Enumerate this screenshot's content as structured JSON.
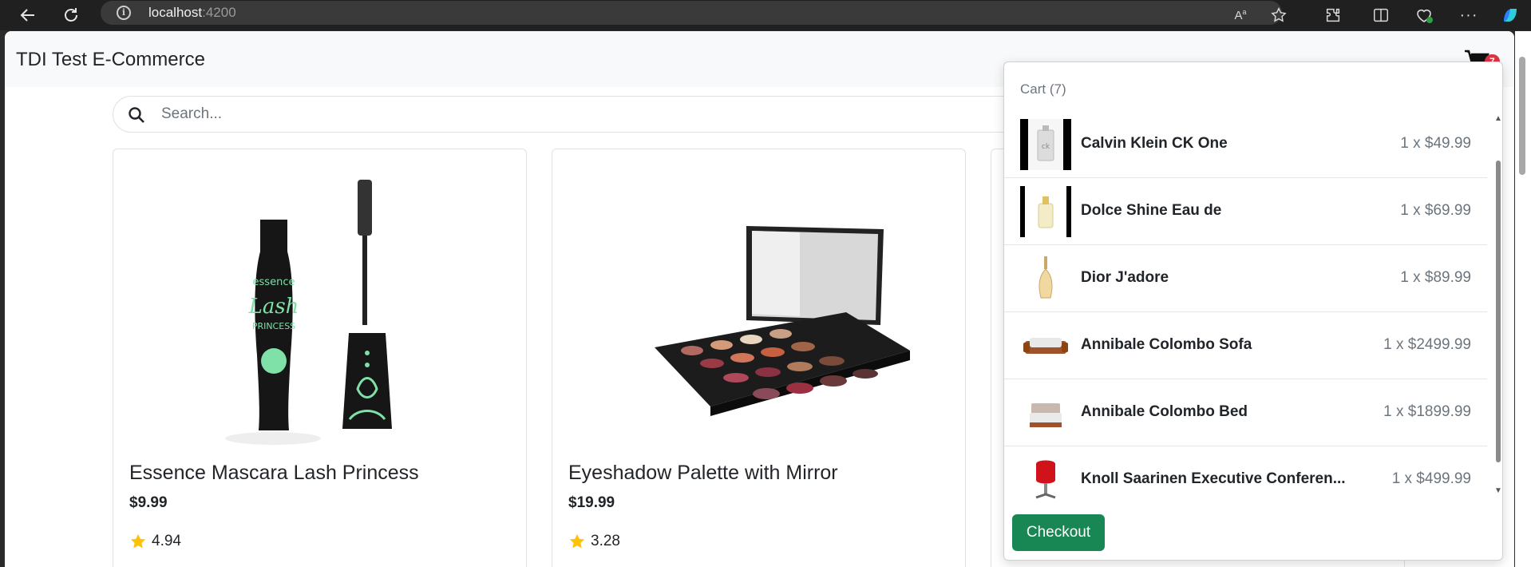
{
  "browser": {
    "url_host": "localhost",
    "url_port": ":4200"
  },
  "header": {
    "brand": "TDI Test E-Commerce",
    "cart_count": "7"
  },
  "search": {
    "placeholder": "Search..."
  },
  "products": [
    {
      "title": "Essence Mascara Lash Princess",
      "price": "$9.99",
      "rating": "4.94"
    },
    {
      "title": "Eyeshadow Palette with Mirror",
      "price": "$19.99",
      "rating": "3.28"
    }
  ],
  "cart": {
    "header": "Cart (7)",
    "items": [
      {
        "name": "Calvin Klein CK One",
        "qty": "1 x $49.99"
      },
      {
        "name": "Dolce Shine Eau de",
        "qty": "1 x $69.99"
      },
      {
        "name": "Dior J'adore",
        "qty": "1 x $89.99"
      },
      {
        "name": "Annibale Colombo Sofa",
        "qty": "1 x $2499.99"
      },
      {
        "name": "Annibale Colombo Bed",
        "qty": "1 x $1899.99"
      },
      {
        "name": "Knoll Saarinen Executive Conferen...",
        "qty": "1 x $499.99"
      }
    ],
    "checkout_label": "Checkout"
  },
  "colors": {
    "checkout": "#198754",
    "badge": "#dc3545",
    "star": "#ffc107"
  }
}
